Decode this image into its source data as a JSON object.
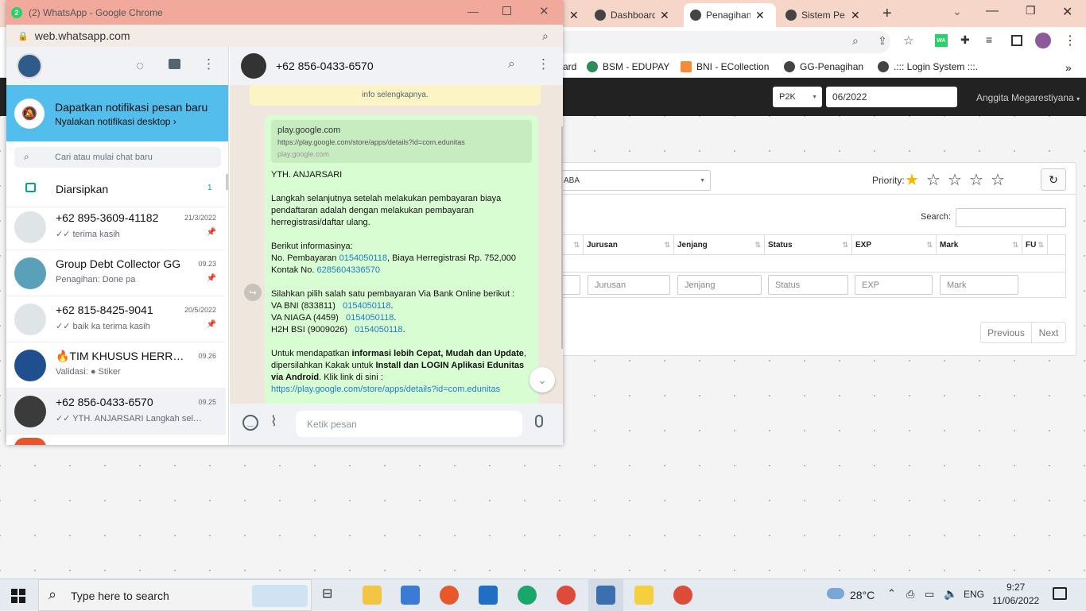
{
  "background_browser": {
    "tabs": [
      {
        "label": "Dashboard"
      },
      {
        "label": "Penagihan"
      },
      {
        "label": "Sistem Pe"
      }
    ],
    "bookmarks": [
      "ard",
      "BSM - EDUPAY",
      "BNI - ECollection",
      "GG-Penagihan",
      ".::: Login System :::."
    ]
  },
  "app": {
    "filter_select": "P2K",
    "period_value": "06/2022",
    "user_name": "Anggita Megarestiyana",
    "dropdown_value": "ABA",
    "priority_label": "Priority:",
    "search_label": "Search:",
    "columns": [
      "Jurusan",
      "Jenjang",
      "Status",
      "EXP",
      "Mark",
      "FU"
    ],
    "filter_placeholders": [
      "Jurusan",
      "Jenjang",
      "Status",
      "EXP",
      "Mark"
    ],
    "prev_label": "Previous",
    "next_label": "Next"
  },
  "whatsapp": {
    "badge": "2",
    "window_title": "(2) WhatsApp - Google Chrome",
    "url": "web.whatsapp.com",
    "notif_title": "Dapatkan notifikasi pesan baru",
    "notif_link": "Nyalakan notifikasi desktop ›",
    "search_placeholder": "Cari atau mulai chat baru",
    "archived_label": "Diarsipkan",
    "archived_count": "1",
    "chats": [
      {
        "name": "+62 895-3609-41182",
        "time": "21/3/2022",
        "msg": "✓✓ terima kasih"
      },
      {
        "name": "Group Debt Collector GG",
        "time": "09.23",
        "msg": "Penagihan: Done pa"
      },
      {
        "name": "+62 815-8425-9041",
        "time": "20/5/2022",
        "msg": "✓✓ baik ka terima kasih"
      },
      {
        "name": "🔥TIM KHUSUS HERREGIST...",
        "time": "09.26",
        "msg": "Validasi: ● Stiker"
      },
      {
        "name": "+62 856-0433-6570",
        "time": "09.25",
        "msg": "✓✓ YTH. ANJARSARI Langkah selanjut..."
      }
    ],
    "active_chat_name": "+62 856-0433-6570",
    "system_note": "info selengkapnya.",
    "link_preview": {
      "title": "play.google.com",
      "url": "https://play.google.com/store/apps/details?id=com.edunitas",
      "domain": "play.google.com"
    },
    "message": {
      "greeting": "YTH. ANJARSARI",
      "p1": [
        "Langkah selanjutnya setelah melakukan pembayaran biaya",
        "pendaftaran adalah dengan melakukan pembayaran",
        "herregistrasi/daftar ulang."
      ],
      "info_title": "Berikut informasinya:",
      "pay_prefix": "No. Pembayaran ",
      "pay_no": "0154050118",
      "pay_suffix": ", Biaya Herregistrasi Rp. 752,000",
      "contact_prefix": "Kontak No. ",
      "contact_no": "6285604336570",
      "bank_intro": "Silahkan pilih salah satu pembayaran Via Bank Online berikut :",
      "banks": [
        {
          "label": "VA BNI (833811)   ",
          "no": "0154050118"
        },
        {
          "label": "VA NIAGA (4459)   ",
          "no": "0154050118"
        },
        {
          "label": "H2H BSI (9009026)   ",
          "no": "0154050118"
        }
      ],
      "app_1": "Untuk mendapatkan ",
      "app_1_bold": "informasi lebih Cepat, Mudah dan Update",
      "app_2": "dipersilahkan Kakak untuk ",
      "app_2_bold": "Install dan LOGIN Aplikasi Edunitas",
      "app_3_bold": "via Android",
      "app_3": ". Klik link di sini :",
      "link": "https://play.google.com/store/apps/details?id=com.edunitas"
    },
    "compose_placeholder": "Ketik pesan"
  },
  "taskbar": {
    "search_placeholder": "Type here to search",
    "weather": "28°C",
    "lang": "ENG",
    "time": "9:27",
    "date": "11/06/2022"
  }
}
